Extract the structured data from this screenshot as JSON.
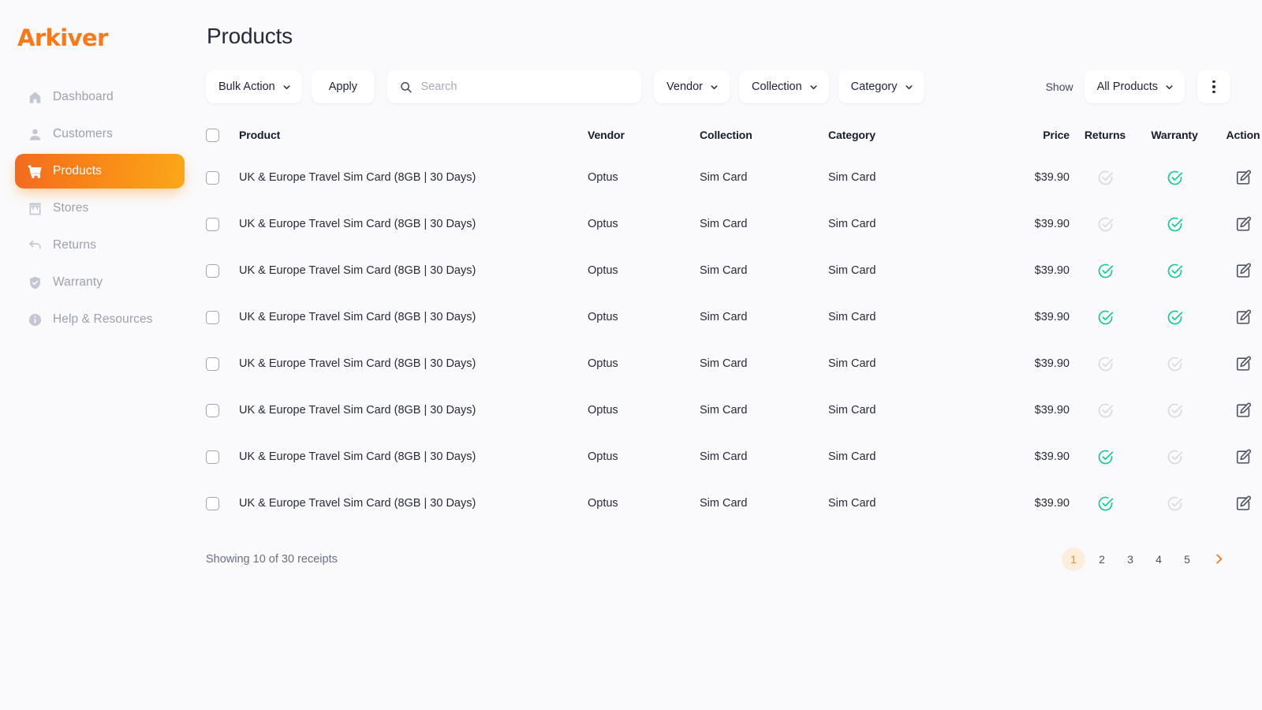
{
  "brand": {
    "name": "Arkiver",
    "color": "#F7791A"
  },
  "sidebar": {
    "items": [
      {
        "label": "Dashboard",
        "icon": "home-icon",
        "active": false
      },
      {
        "label": "Customers",
        "icon": "user-icon",
        "active": false
      },
      {
        "label": "Products",
        "icon": "cart-icon",
        "active": true
      },
      {
        "label": "Stores",
        "icon": "store-icon",
        "active": false
      },
      {
        "label": "Returns",
        "icon": "arrow-back-icon",
        "active": false
      },
      {
        "label": "Warranty",
        "icon": "shield-check-icon",
        "active": false
      },
      {
        "label": "Help & Resources",
        "icon": "info-icon",
        "active": false
      }
    ]
  },
  "header": {
    "title": "Products"
  },
  "toolbar": {
    "bulk_action_label": "Bulk Action",
    "apply_label": "Apply",
    "search_placeholder": "Search",
    "search_value": "",
    "vendor_label": "Vendor",
    "collection_label": "Collection",
    "category_label": "Category",
    "show_label": "Show",
    "show_value": "All Products",
    "more_menu": "kebab-menu-icon"
  },
  "table": {
    "columns": [
      "Product",
      "Vendor",
      "Collection",
      "Category",
      "Price",
      "Returns",
      "Warranty",
      "Action"
    ],
    "rows": [
      {
        "product": "UK & Europe Travel Sim Card (8GB | 30 Days)",
        "vendor": "Optus",
        "collection": "Sim Card",
        "category": "Sim Card",
        "price": "$39.90",
        "returns": false,
        "warranty": true,
        "checked": false
      },
      {
        "product": "UK & Europe Travel Sim Card (8GB | 30 Days)",
        "vendor": "Optus",
        "collection": "Sim Card",
        "category": "Sim Card",
        "price": "$39.90",
        "returns": false,
        "warranty": true,
        "checked": false
      },
      {
        "product": "UK & Europe Travel Sim Card (8GB | 30 Days)",
        "vendor": "Optus",
        "collection": "Sim Card",
        "category": "Sim Card",
        "price": "$39.90",
        "returns": true,
        "warranty": true,
        "checked": false
      },
      {
        "product": "UK & Europe Travel Sim Card (8GB | 30 Days)",
        "vendor": "Optus",
        "collection": "Sim Card",
        "category": "Sim Card",
        "price": "$39.90",
        "returns": true,
        "warranty": true,
        "checked": false
      },
      {
        "product": "UK & Europe Travel Sim Card (8GB | 30 Days)",
        "vendor": "Optus",
        "collection": "Sim Card",
        "category": "Sim Card",
        "price": "$39.90",
        "returns": false,
        "warranty": false,
        "checked": false
      },
      {
        "product": "UK & Europe Travel Sim Card (8GB | 30 Days)",
        "vendor": "Optus",
        "collection": "Sim Card",
        "category": "Sim Card",
        "price": "$39.90",
        "returns": false,
        "warranty": false,
        "checked": false
      },
      {
        "product": "UK & Europe Travel Sim Card (8GB | 30 Days)",
        "vendor": "Optus",
        "collection": "Sim Card",
        "category": "Sim Card",
        "price": "$39.90",
        "returns": true,
        "warranty": false,
        "checked": false
      },
      {
        "product": "UK & Europe Travel Sim Card (8GB | 30 Days)",
        "vendor": "Optus",
        "collection": "Sim Card",
        "category": "Sim Card",
        "price": "$39.90",
        "returns": true,
        "warranty": false,
        "checked": false
      }
    ]
  },
  "footer": {
    "showing_text": "Showing 10 of 30 receipts",
    "pages": [
      "1",
      "2",
      "3",
      "4",
      "5"
    ],
    "current_page": "1",
    "next_icon": "chevron-right-icon"
  },
  "colors": {
    "accent_orange": "#F7791A",
    "accent_orange_dark": "#F26A1F",
    "accent_amber": "#FBA818",
    "status_active_green": "#0FCE8B",
    "status_inactive_gray": "#D7DAE2",
    "page_bg": "#FAFAFC"
  }
}
